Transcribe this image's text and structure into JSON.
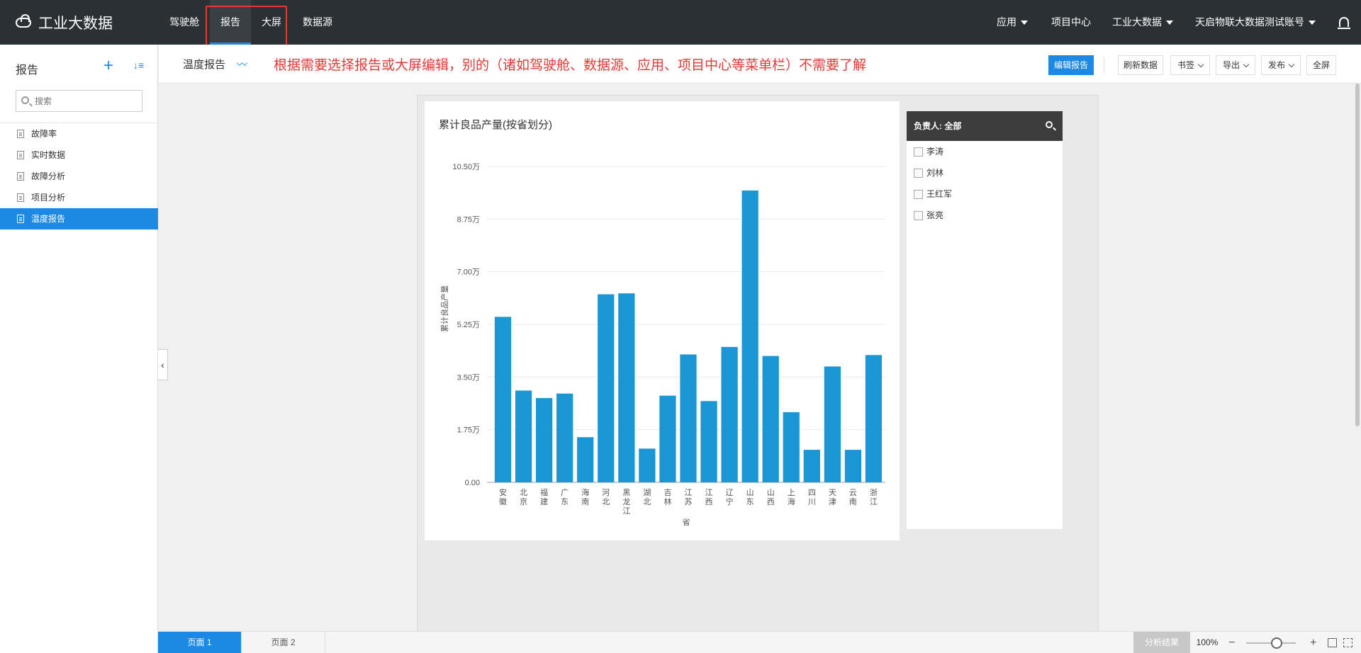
{
  "app": {
    "brand": "工业大数据"
  },
  "nav": {
    "items": [
      {
        "label": "驾驶舱",
        "active": false
      },
      {
        "label": "报告",
        "active": true
      },
      {
        "label": "大屏",
        "active": false
      },
      {
        "label": "数据源",
        "active": false
      }
    ],
    "right": {
      "apps": "应用",
      "project_center": "项目中心",
      "industry": "工业大数据",
      "account": "天启物联大数据测试账号"
    }
  },
  "sidebar": {
    "title": "报告",
    "search_placeholder": "搜索",
    "items": [
      {
        "label": "故障率",
        "active": false
      },
      {
        "label": "实时数据",
        "active": false
      },
      {
        "label": "故障分析",
        "active": false
      },
      {
        "label": "项目分析",
        "active": false
      },
      {
        "label": "温度报告",
        "active": true
      }
    ]
  },
  "report": {
    "name": "温度报告",
    "annotation": "根据需要选择报告或大屏编辑，别的（诸如驾驶舱、数据源、应用、项目中心等菜单栏）不需要了解",
    "toolbar": {
      "edit": "编辑报告",
      "refresh": "刷新数据",
      "bookmark": "书签",
      "export": "导出",
      "publish": "发布",
      "fullscreen": "全屏"
    }
  },
  "chart_data": {
    "type": "bar",
    "title": "累计良品产量(按省划分)",
    "xlabel": "省",
    "ylabel": "累计良品产量",
    "categories": [
      "安徽",
      "北京",
      "福建",
      "广东",
      "海南",
      "河北",
      "黑龙江",
      "湖北",
      "吉林",
      "江苏",
      "江西",
      "辽宁",
      "山东",
      "山西",
      "上海",
      "四川",
      "天津",
      "云南",
      "浙江"
    ],
    "values": [
      55000,
      30500,
      28000,
      29500,
      15000,
      62500,
      62800,
      11200,
      28800,
      42500,
      27000,
      45000,
      97000,
      42000,
      23300,
      10800,
      38500,
      10800,
      42300
    ],
    "ylim": [
      0,
      105000
    ],
    "yticks": [
      "0.00",
      "1.75万",
      "3.50万",
      "5.25万",
      "7.00万",
      "8.75万",
      "10.50万"
    ],
    "color": "#1a96d4",
    "grid": true
  },
  "filter": {
    "header": "负责人: 全部",
    "options": [
      "李涛",
      "刘林",
      "王红军",
      "张亮"
    ]
  },
  "pages": [
    "页面 1",
    "页面 2"
  ],
  "bottom": {
    "analysis": "分析结果",
    "zoom": "100%"
  }
}
